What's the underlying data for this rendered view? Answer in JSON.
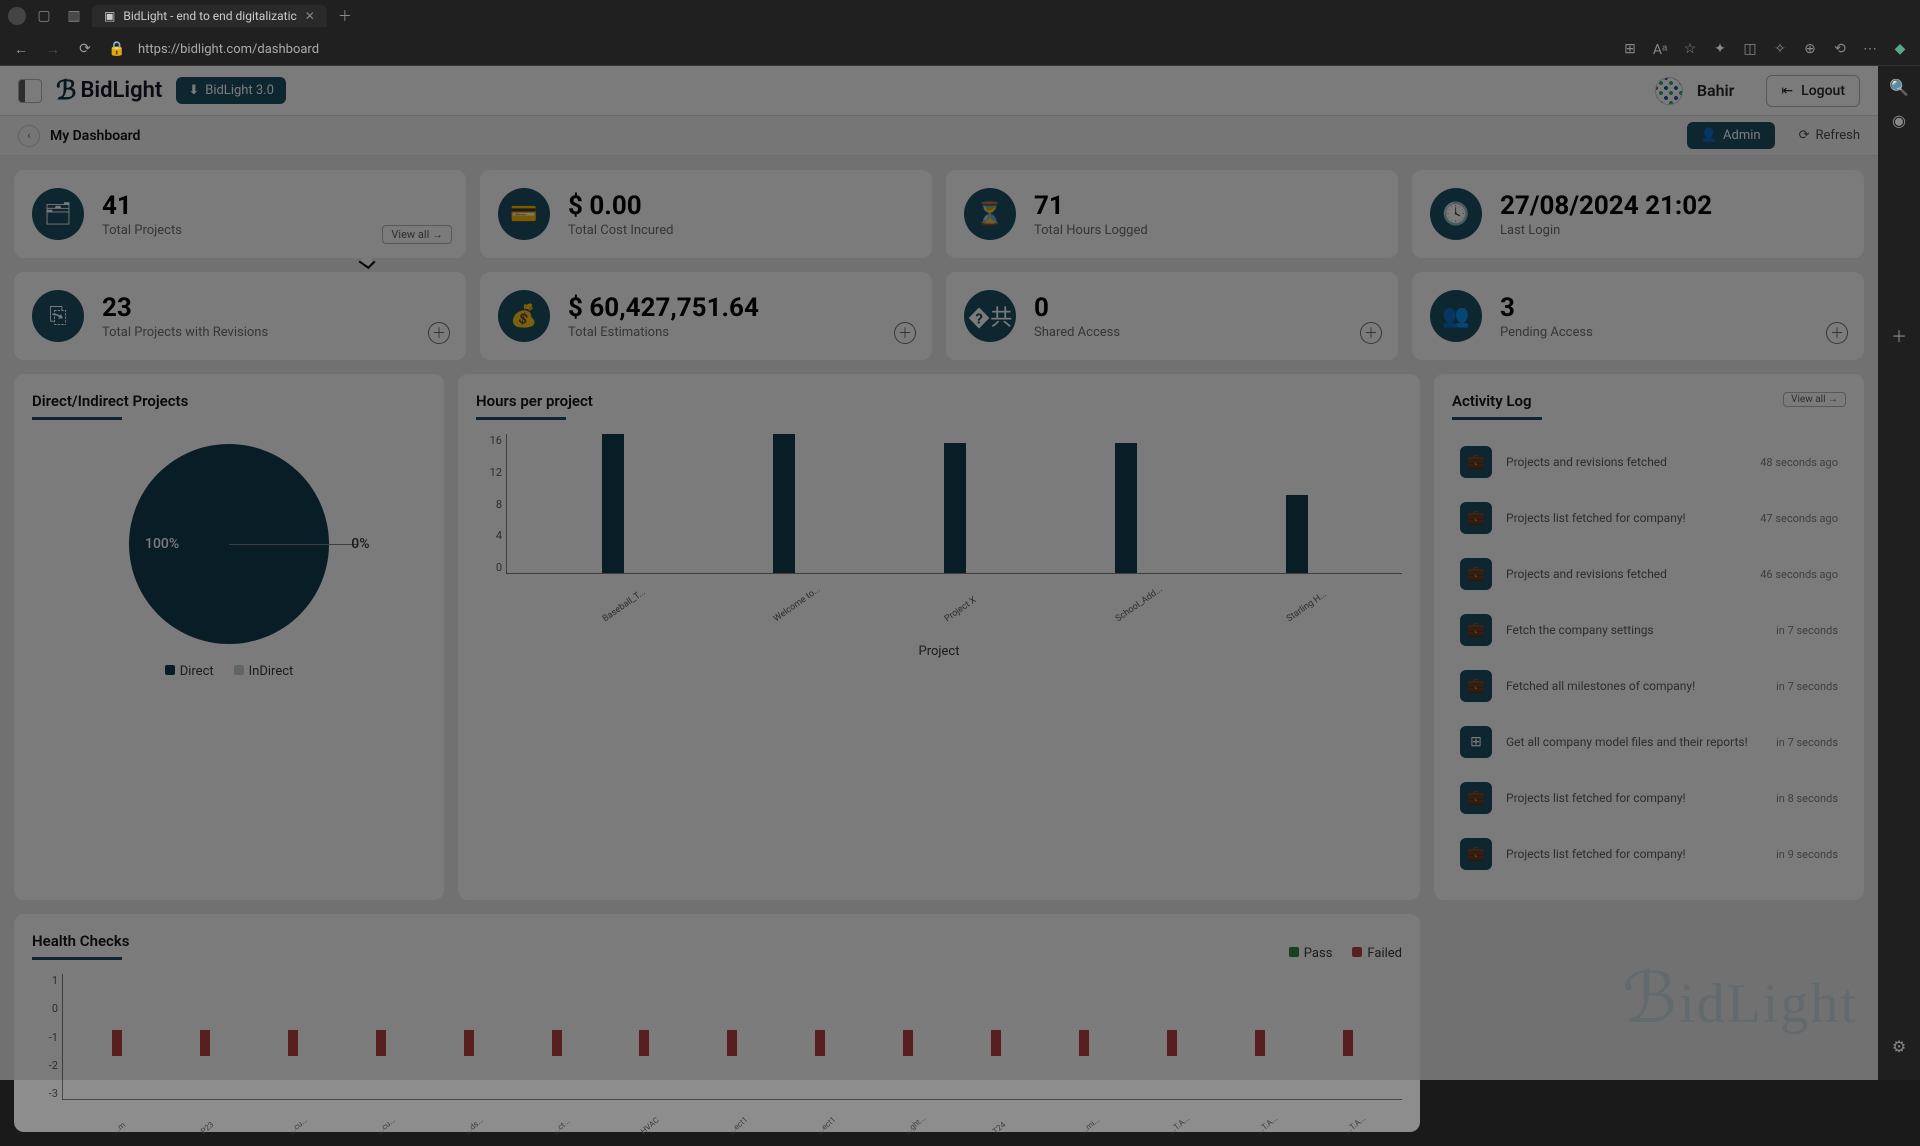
{
  "browser": {
    "tab_title": "BidLight - end to end digitalizatic",
    "url": "https://bidlight.com/dashboard"
  },
  "header": {
    "logo_text": "BidLight",
    "download_label": "BidLight 3.0",
    "username": "Bahir",
    "logout_label": "Logout"
  },
  "subheader": {
    "title": "My Dashboard",
    "admin_label": "Admin",
    "refresh_label": "Refresh"
  },
  "stats": {
    "projects": {
      "val": "41",
      "lbl": "Total Projects",
      "view_all": "View all →"
    },
    "cost": {
      "val": "$ 0.00",
      "lbl": "Total Cost Incured"
    },
    "hours": {
      "val": "71",
      "lbl": "Total Hours Logged"
    },
    "login": {
      "val": "27/08/2024 21:02",
      "lbl": "Last Login"
    },
    "revisions": {
      "val": "23",
      "lbl": "Total Projects with Revisions"
    },
    "estimations": {
      "val": "$ 60,427,751.64",
      "lbl": "Total Estimations"
    },
    "shared": {
      "val": "0",
      "lbl": "Shared Access"
    },
    "pending": {
      "val": "3",
      "lbl": "Pending Access"
    }
  },
  "pie": {
    "title": "Direct/Indirect Projects",
    "direct_pct": "100%",
    "indirect_pct": "0%",
    "legend_direct": "Direct",
    "legend_indirect": "InDirect"
  },
  "bar": {
    "title": "Hours per project",
    "legend": "Project",
    "yticks": [
      "16",
      "12",
      "8",
      "4",
      "0"
    ]
  },
  "activity": {
    "title": "Activity Log",
    "view_all": "View all →",
    "items": [
      {
        "text": "Projects and revisions fetched",
        "time": "48 seconds ago"
      },
      {
        "text": "Projects list fetched for company!",
        "time": "47 seconds ago"
      },
      {
        "text": "Projects and revisions fetched",
        "time": "46 seconds ago"
      },
      {
        "text": "Fetch the company settings",
        "time": "in 7 seconds"
      },
      {
        "text": "Fetched all milestones of company!",
        "time": "in 7 seconds"
      },
      {
        "text": "Get all company model files and their reports!",
        "time": "in 7 seconds"
      },
      {
        "text": "Projects list fetched for company!",
        "time": "in 8 seconds"
      },
      {
        "text": "Projects list fetched for company!",
        "time": "in 9 seconds"
      }
    ]
  },
  "health": {
    "title": "Health Checks",
    "legend_pass": "Pass",
    "legend_fail": "Failed",
    "yticks": [
      "1",
      "0",
      "-1",
      "-2",
      "-3"
    ]
  },
  "chart_data": [
    {
      "type": "pie",
      "title": "Direct/Indirect Projects",
      "series": [
        {
          "name": "Direct",
          "value": 100
        },
        {
          "name": "InDirect",
          "value": 0
        }
      ]
    },
    {
      "type": "bar",
      "title": "Hours per project",
      "xlabel": "",
      "ylabel": "",
      "ylim": [
        0,
        16
      ],
      "categories": [
        "Baseball_T...",
        "Welcome to...",
        "Project X",
        "School_Add...",
        "Starling H..."
      ],
      "values": [
        16,
        16,
        15,
        15,
        9
      ],
      "legend": [
        "Project"
      ]
    },
    {
      "type": "bar",
      "title": "Health Checks",
      "xlabel": "",
      "ylabel": "",
      "ylim": [
        -3,
        1
      ],
      "categories": [
        "...m",
        "P23",
        "...cu...",
        "...cu...",
        "...ds...",
        "...ct...",
        "HVAC",
        "...ect1",
        "...ect1",
        "...ght...",
        "T24",
        "...mi...",
        "...T.A...",
        "...T.A...",
        "...T.A..."
      ],
      "series": [
        {
          "name": "Pass",
          "values": [
            0,
            0,
            0,
            0,
            0,
            0,
            0,
            0,
            0,
            0,
            0,
            0,
            0,
            0,
            0
          ]
        },
        {
          "name": "Failed",
          "values": [
            -1,
            -1,
            -1,
            -1,
            -1,
            -1,
            -1,
            -1,
            -1,
            -1,
            -1,
            -1,
            -1,
            -1,
            -1
          ]
        }
      ],
      "legend": [
        "Pass",
        "Failed"
      ]
    }
  ]
}
